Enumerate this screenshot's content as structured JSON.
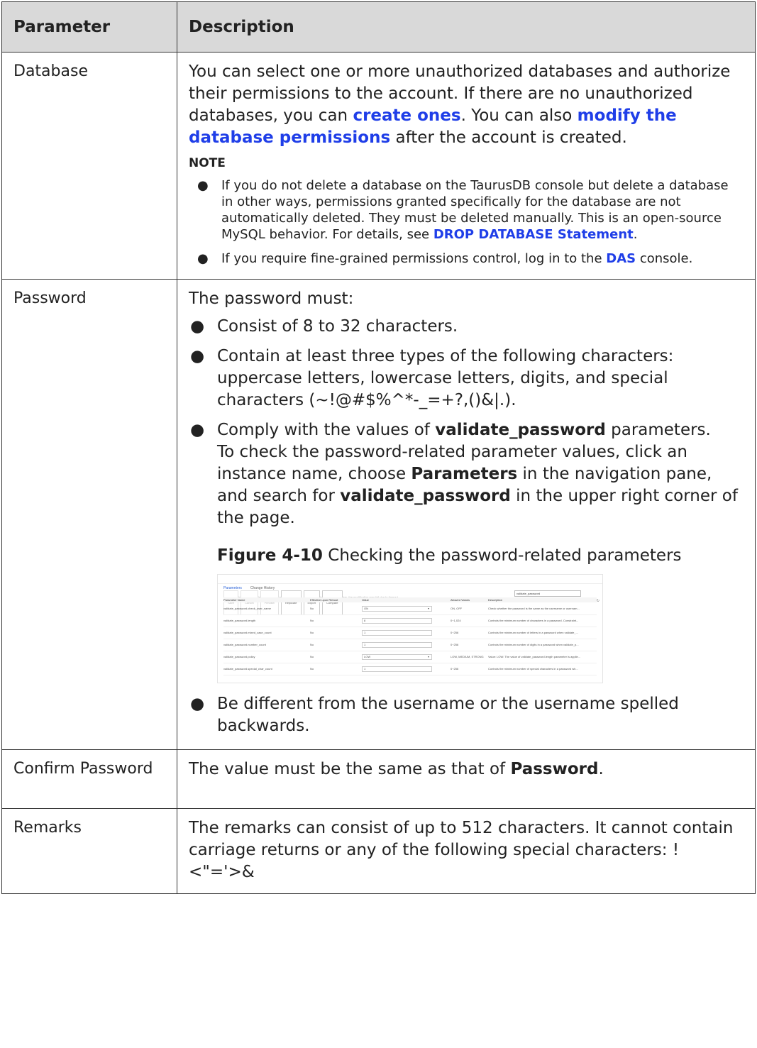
{
  "table": {
    "headers": [
      "Parameter",
      "Description"
    ],
    "database": {
      "name": "Database",
      "p1_a": "You can select one or more unauthorized databases and authorize their permissions to the account. If there are no unauthorized databases, you can ",
      "p1_link1": "create ones",
      "p1_b": ". You can also ",
      "p1_link2": "modify the database permissions",
      "p1_c": " after the account is created.",
      "note_title": "NOTE",
      "note1_a": "If you do not delete a database on the TaurusDB console but delete a database in other ways, permissions granted specifically for the database are not automatically deleted. They must be deleted manually. This is an open-source MySQL behavior. For details, see ",
      "note1_link": "DROP DATABASE Statement",
      "note1_b": ".",
      "note2_a": "If you require fine-grained permissions control, log in to the ",
      "note2_link": "DAS",
      "note2_b": " console."
    },
    "password": {
      "name": "Password",
      "intro": "The password must:",
      "b1": "Consist of 8 to 32 characters.",
      "b2": "Contain at least three types of the following characters: uppercase letters, lowercase letters, digits, and special characters (~!@#$%^*-_=+?,()&|.).",
      "b3_a": "Comply with the values of ",
      "b3_bold": "validate_password",
      "b3_b": " parameters.",
      "b3_c": "To check the password-related parameter values, click an instance name, choose ",
      "b3_bold2": "Parameters",
      "b3_d": " in the navigation pane, and search for ",
      "b3_bold3": "validate_password",
      "b3_e": " in the upper right corner of the page.",
      "figure_label": "Figure 4-10",
      "figure_caption": " Checking the password-related parameters",
      "b4": "Be different from the username or the username spelled backwards."
    },
    "confirm": {
      "name": "Confirm Password",
      "text_a": "The value must be the same as that of ",
      "text_bold": "Password",
      "text_b": "."
    },
    "remarks": {
      "name": "Remarks",
      "text": "The remarks can consist of up to 512 characters. It cannot contain carriage returns or any of the following special characters: !<\"='>&"
    }
  },
  "figure": {
    "tabs": [
      "Parameters",
      "Change History"
    ],
    "notice": "You are advised to change fewer than 30 parameters at a time. If you modify too many parameters, the modification may fail due to timeout.",
    "buttons": [
      "Save",
      "Cancel",
      "Preview",
      "Replicate",
      "Export",
      "Compare"
    ],
    "search_value": "validate_password",
    "columns": [
      "Parameter Name",
      "Effective upon Reboot",
      "Value",
      "Allowed Values",
      "Description"
    ],
    "rows": [
      {
        "name": "validate_password.check_user_name",
        "reboot": "No",
        "value": "ON",
        "allowed": "ON, OFF",
        "desc": "Check whether the password is the same as the username or usernam..."
      },
      {
        "name": "validate_password.length",
        "reboot": "No",
        "value": "8",
        "allowed": "0~1,024",
        "desc": "Controls the minimum number of characters in a password. Constraint..."
      },
      {
        "name": "validate_password.mixed_case_count",
        "reboot": "No",
        "value": "1",
        "allowed": "0~256",
        "desc": "Controls the minimum number of letters in a password when validate_..."
      },
      {
        "name": "validate_password.number_count",
        "reboot": "No",
        "value": "1",
        "allowed": "0~256",
        "desc": "Controls the minimum number of digits in a password when validate_p..."
      },
      {
        "name": "validate_password.policy",
        "reboot": "No",
        "value": "LOW",
        "allowed": "LOW, MEDIUM, STRONG",
        "desc": "Value: LOW: The value of validate_password.length parameter is applie..."
      },
      {
        "name": "validate_password.special_char_count",
        "reboot": "No",
        "value": "1",
        "allowed": "0~256",
        "desc": "Controls the minimum number of special characters in a password wh..."
      }
    ]
  }
}
